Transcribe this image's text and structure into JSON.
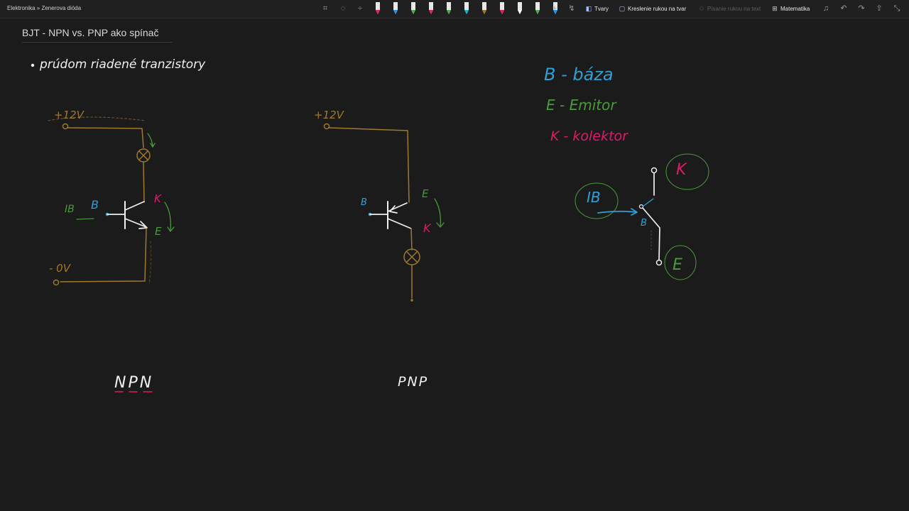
{
  "breadcrumb": "Elektronika » Zenerova dióda",
  "toolbar": {
    "shapes_label": "Tvary",
    "ink_to_shape_label": "Kreslenie rukou na tvar",
    "ink_to_text_label": "Písanie rukou na text",
    "math_label": "Matematika",
    "pens": [
      {
        "color": "#e8e8e8",
        "tip": "#e91e63"
      },
      {
        "color": "#e8e8e8",
        "tip": "#2196f3"
      },
      {
        "color": "#e8e8e8",
        "tip": "#4caf50"
      },
      {
        "color": "#e8e8e8",
        "tip": "#e91e63"
      },
      {
        "color": "#e8e8e8",
        "tip": "#4caf50"
      },
      {
        "color": "#e8e8e8",
        "tip": "#00bcd4"
      },
      {
        "color": "#e8e8e8",
        "tip": "#a0782c"
      },
      {
        "color": "#e8e8e8",
        "tip": "#e91e63"
      },
      {
        "color": "#e8e8e8",
        "tip": "#ffffff"
      },
      {
        "color": "#e8e8e8",
        "tip": "#4caf50"
      },
      {
        "color": "#e8e8e8",
        "tip": "#2196f3"
      }
    ]
  },
  "page": {
    "title": "BJT - NPN vs. PNP ako spínač"
  },
  "notes": {
    "bullet_text": "prúdom riadené tranzistory",
    "legend_b": "B - báza",
    "legend_e": "E - Emitor",
    "legend_k": "K - kolektor"
  },
  "npn": {
    "supply": "+12V",
    "ground": "- 0V",
    "ib": "IB",
    "b": "B",
    "k": "K",
    "e": "E",
    "caption": "NPN"
  },
  "pnp": {
    "supply": "+12V",
    "b": "B",
    "e": "E",
    "k": "K",
    "caption": "PNP"
  },
  "symbol": {
    "ib": "IB",
    "b": "B",
    "k": "K",
    "e": "E"
  },
  "colors": {
    "background": "#1b1b1b",
    "wire": "#a0782c",
    "blue": "#2f9fd6",
    "green": "#4a9a3a",
    "magenta": "#e01a6a",
    "white": "#f0f0f0"
  }
}
